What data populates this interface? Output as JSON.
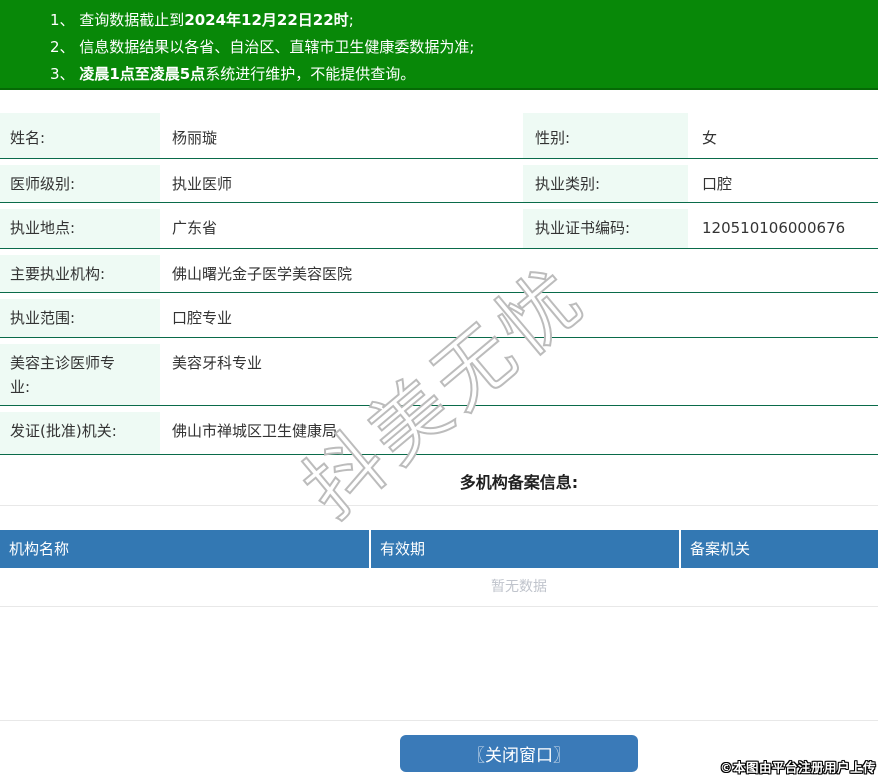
{
  "notices": {
    "n1_pre": "1、 查询数据截止到",
    "n1_bold": "2024年12月22日22时",
    "n1_post": ";",
    "n2_pre": "2、 信息数据结果以各省、自治区、直辖市卫生健康委数据为准;",
    "n2_bold": "",
    "n2_post": "",
    "n3_pre": "3、 ",
    "n3_bold": "凌晨1点至凌晨5点",
    "n3_post": "系统进行维护，不能提供查询。"
  },
  "doctor": {
    "rows": [
      {
        "label": "姓名:",
        "value": "杨丽璇",
        "label2": "性别:",
        "value2": "女"
      },
      {
        "label": "医师级别:",
        "value": "执业医师",
        "label2": "执业类别:",
        "value2": "口腔"
      },
      {
        "label": "执业地点:",
        "value": "广东省",
        "label2": "执业证书编码:",
        "value2": "120510106000676"
      },
      {
        "label": "主要执业机构:",
        "value": "佛山曙光金子医学美容医院"
      },
      {
        "label": "执业范围:",
        "value": "口腔专业"
      },
      {
        "label": "美容主诊医师专业:",
        "value": "美容牙科专业"
      },
      {
        "label": "发证(批准)机关:",
        "value": "佛山市禅城区卫生健康局"
      }
    ]
  },
  "registry": {
    "title": "多机构备案信息:",
    "columns": [
      "机构名称",
      "有效期",
      "备案机关"
    ],
    "empty_text": "暂无数据"
  },
  "footer": {
    "close_button": "〖关闭窗口〗",
    "upload_stamp": "©本图由平台注册用户上传"
  },
  "watermark": {
    "text": "抖美无忧"
  },
  "colors": {
    "banner_green": "#088808",
    "row_border_green": "#0a6b4a",
    "label_bg_mint": "#eefaf4",
    "header_blue": "#3378b3",
    "button_blue": "#3a7ab8",
    "empty_text_gray": "#c0c4cc"
  }
}
